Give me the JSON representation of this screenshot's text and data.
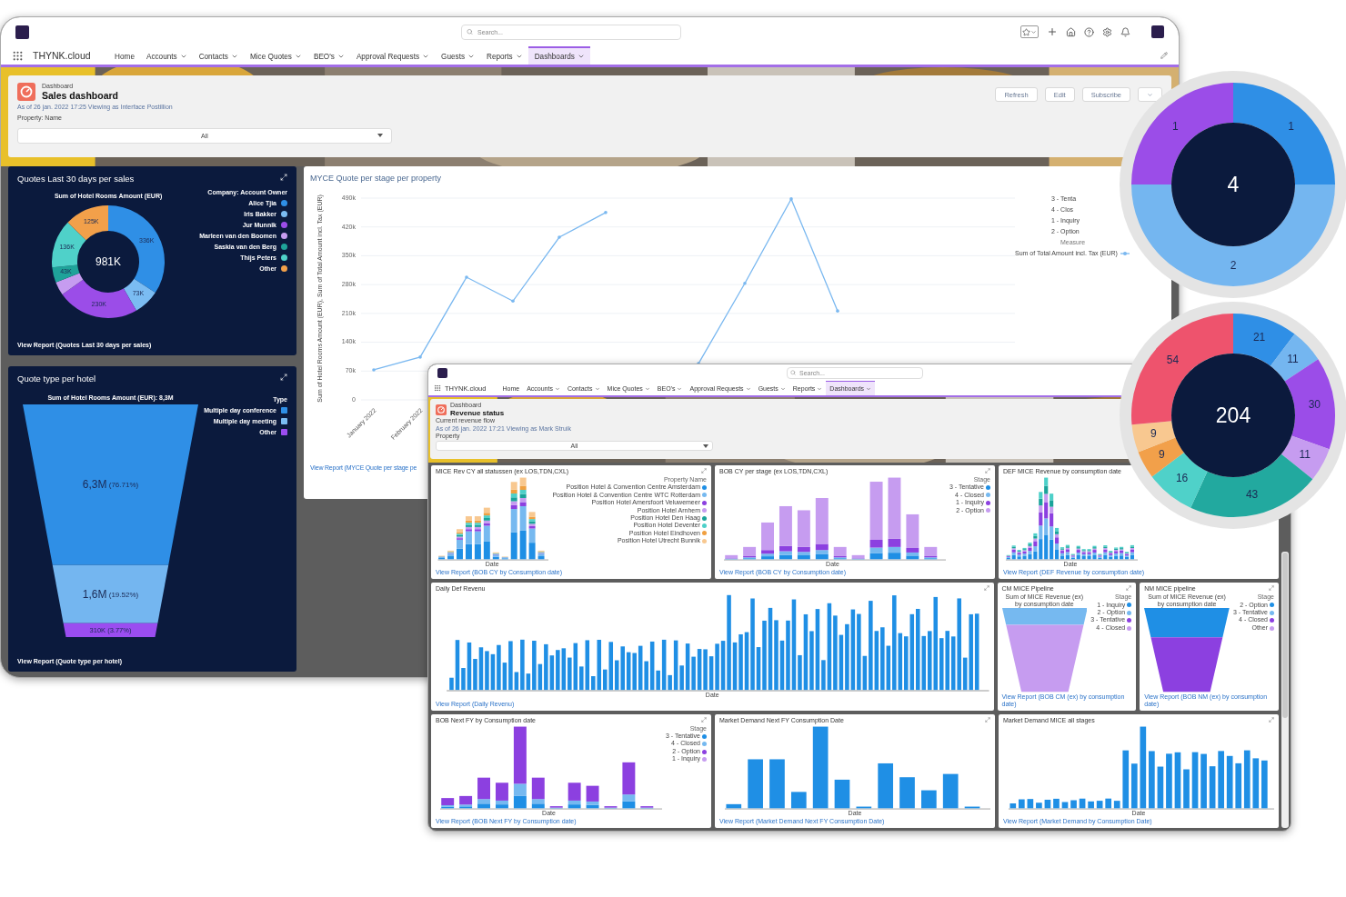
{
  "main_window": {
    "app_name": "THYNK.cloud",
    "search": {
      "placeholder": "Search..."
    },
    "nav": [
      {
        "label": "Home",
        "has_menu": false,
        "selected": false
      },
      {
        "label": "Accounts",
        "has_menu": true,
        "selected": false
      },
      {
        "label": "Contacts",
        "has_menu": true,
        "selected": false
      },
      {
        "label": "Mice Quotes",
        "has_menu": true,
        "selected": false
      },
      {
        "label": "BEO's",
        "has_menu": true,
        "selected": false
      },
      {
        "label": "Approval Requests",
        "has_menu": true,
        "selected": false
      },
      {
        "label": "Guests",
        "has_menu": true,
        "selected": false
      },
      {
        "label": "Reports",
        "has_menu": true,
        "selected": false
      },
      {
        "label": "Dashboards",
        "has_menu": true,
        "selected": true
      }
    ],
    "header": {
      "type_label": "Dashboard",
      "title": "Sales dashboard",
      "meta": "As of 26 jan. 2022 17:25 Viewing as Interface Postillion",
      "filter_label": "Property: Name",
      "filter_value": "All",
      "buttons": [
        "Refresh",
        "Edit",
        "Subscribe"
      ]
    },
    "quotes_panel": {
      "title": "Quotes Last 30 days per sales",
      "subtitle": "Sum of Hotel Rooms Amount (EUR)",
      "total": "981K",
      "legend_title": "Company: Account Owner",
      "link": "View Report (Quotes Last 30 days per sales)",
      "chart_data": {
        "type": "donut",
        "categories": [
          "Alice Tjia",
          "Iris Bakker",
          "Jur Munnik",
          "Marleen van den Boomen",
          "Saskia van den Berg",
          "Thijs Peters",
          "Other"
        ],
        "values": [
          336,
          73,
          230,
          38,
          43,
          136,
          125
        ],
        "colors": [
          "#2f8fe6",
          "#7bbcf2",
          "#9b4de8",
          "#c69cf0",
          "#1fa39a",
          "#4fd1c9",
          "#f2a04a"
        ],
        "value_labels": [
          "336K",
          "73K",
          "230K",
          null,
          "43K",
          "136K",
          "125K"
        ]
      }
    },
    "funnel_panel": {
      "title": "Quote type per hotel",
      "subtitle": "Sum of Hotel Rooms Amount (EUR): 8,3M",
      "legend_title": "Type",
      "link": "View Report (Quote type per hotel)",
      "legend": [
        {
          "label": "Multiple day conference",
          "color": "#2f8fe6"
        },
        {
          "label": "Multiple day meeting",
          "color": "#7bbcf2"
        },
        {
          "label": "Other",
          "color": "#9b4df0"
        }
      ],
      "segments": [
        {
          "value": "6,3M",
          "percent": "(76.71%)",
          "color": "#2f8fe6"
        },
        {
          "value": "1,6M",
          "percent": "(19.52%)",
          "color": "#74b6f0"
        },
        {
          "value": "310K",
          "percent": "(3.77%)",
          "color": "#9b4df0"
        }
      ]
    },
    "line_panel": {
      "title": "MYCE Quote per stage per property",
      "legend": [
        "3 - Tenta",
        "4 - Clos",
        "1 - Inquiry",
        "2 - Option"
      ],
      "measure_title": "Measure",
      "link": "View Report (MYCE Quote per stage pe",
      "chart_data": {
        "type": "line",
        "ylabel": "Sum of Hotel Rooms Amount (EUR), Sum of Total Amount incl. Tax (EUR)",
        "categories": [
          "January 2022",
          "February 2022",
          null,
          null,
          null,
          null,
          null,
          null,
          null,
          null,
          null,
          null
        ],
        "ylim": [
          0,
          490
        ],
        "yticks": [
          {
            "value": 0,
            "label": "0"
          },
          {
            "value": 70,
            "label": "70k"
          },
          {
            "value": 140,
            "label": "140k"
          },
          {
            "value": 210,
            "label": "210k"
          },
          {
            "value": 280,
            "label": "280k"
          },
          {
            "value": 350,
            "label": "350k"
          },
          {
            "value": 420,
            "label": "420k"
          },
          {
            "value": 490,
            "label": "490k"
          }
        ],
        "series": [
          {
            "name": "Sum of Total Amount incl. Tax (EUR)",
            "color": "#7ab8f0",
            "values": [
              73,
              104,
              298,
              240,
              395,
              455,
              null,
              88,
              283,
              488,
              216,
              null
            ]
          }
        ],
        "grid": true
      }
    }
  },
  "revenue_window": {
    "app_name": "THYNK.cloud",
    "search": {
      "placeholder": "Search..."
    },
    "nav": [
      {
        "label": "Home",
        "has_menu": false,
        "selected": false
      },
      {
        "label": "Accounts",
        "has_menu": true,
        "selected": false
      },
      {
        "label": "Contacts",
        "has_menu": true,
        "selected": false
      },
      {
        "label": "Mice Quotes",
        "has_menu": true,
        "selected": false
      },
      {
        "label": "BEO's",
        "has_menu": true,
        "selected": false
      },
      {
        "label": "Approval Requests",
        "has_menu": true,
        "selected": false
      },
      {
        "label": "Guests",
        "has_menu": true,
        "selected": false
      },
      {
        "label": "Reports",
        "has_menu": true,
        "selected": false
      },
      {
        "label": "Dashboards",
        "has_menu": true,
        "selected": true
      }
    ],
    "header": {
      "type_label": "Dashboard",
      "title": "Revenue status",
      "subtitle": "Current revenue flow",
      "meta": "As of 26 jan. 2022 17:21 Viewing as Mark Struik",
      "filter_label": "Property",
      "filter_value": "All"
    },
    "panels": [
      {
        "kind": "stacked_bars",
        "title": "MICE Rev CY all statussen (ex LOS,TDN,CXL)",
        "legend_title": "Property Name",
        "xlabel": "Date",
        "link": "View Report (BOB CY by Consumption date)",
        "legend": [
          {
            "label": "Position Hotel & Convention Centre Amsterdam",
            "color": "#1f8fe5"
          },
          {
            "label": "Position Hotel & Convention Centre WTC Rotterdam",
            "color": "#76b9f0"
          },
          {
            "label": "Position Hotel Amersfoort Veluwemeer",
            "color": "#8c40e0"
          },
          {
            "label": "Position Hotel Arnhem",
            "color": "#c69cf0"
          },
          {
            "label": "Position Hotel Den Haag",
            "color": "#1aa39a"
          },
          {
            "label": "Position Hotel Deventer",
            "color": "#4dd0c9"
          },
          {
            "label": "Position Hotel Eindhoven",
            "color": "#f0a040"
          },
          {
            "label": "Position Hotel Utrecht Bunnik",
            "color": "#f8c890"
          }
        ]
      },
      {
        "kind": "stacked_bars",
        "title": "BOB CY per stage (ex LOS,TDN,CXL)",
        "legend_title": "Stage",
        "xlabel": "Date",
        "link": "View Report (BOB CY by Consumption date)",
        "legend": [
          {
            "label": "3 - Tentative",
            "color": "#1f8fe5"
          },
          {
            "label": "4 - Closed",
            "color": "#76b9f0"
          },
          {
            "label": "1 - Inquiry",
            "color": "#8c40e0"
          },
          {
            "label": "2 - Option",
            "color": "#c69cf0"
          }
        ]
      },
      {
        "kind": "stacked_bars",
        "title": "DEF MICE Revenue by consumption date",
        "xlabel": "Date",
        "link": "View Report (DEF Revenue by consumption date)"
      },
      {
        "kind": "bars",
        "title": "Daily Def Revenu",
        "xlabel": "Date",
        "link": "View Report (Daily Revenu)"
      },
      {
        "kind": "funnel",
        "title": "CM MICE Pipeline",
        "subtitle": "Sum of MICE Revenue (ex) by consumption date",
        "legend_title": "Stage",
        "link": "View Report (BOB CM (ex) by consumption date)",
        "legend": [
          {
            "label": "1 - Inquiry",
            "color": "#1f8fe5"
          },
          {
            "label": "2 - Option",
            "color": "#76b9f0"
          },
          {
            "label": "3 - Tentative",
            "color": "#8c40e0"
          },
          {
            "label": "4 - Closed",
            "color": "#c69cf0"
          }
        ]
      },
      {
        "kind": "funnel",
        "title": "NM MICE pipeline",
        "subtitle": "Sum of MICE Revenue (ex) by consumption date",
        "legend_title": "Stage",
        "link": "View Report (BOB NM (ex) by consumption date)",
        "legend": [
          {
            "label": "2 - Option",
            "color": "#1f8fe5"
          },
          {
            "label": "3 - Tentative",
            "color": "#76b9f0"
          },
          {
            "label": "4 - Closed",
            "color": "#8c40e0"
          },
          {
            "label": "Other",
            "color": "#c69cf0"
          }
        ]
      },
      {
        "kind": "stacked_bars",
        "title": "BOB Next FY by Consumption date",
        "legend_title": "Stage",
        "xlabel": "Date",
        "link": "View Report (BOB Next FY by Consumption date)",
        "legend": [
          {
            "label": "3 - Tentative",
            "color": "#1f8fe5"
          },
          {
            "label": "4 - Closed",
            "color": "#76b9f0"
          },
          {
            "label": "2 - Option",
            "color": "#8c40e0"
          },
          {
            "label": "1 - Inquiry",
            "color": "#c69cf0"
          }
        ]
      },
      {
        "kind": "bars",
        "title": "Market Demand Next FY Consumption Date",
        "xlabel": "Date",
        "link": "View Report (Market Demand Next FY Consumption Date)"
      },
      {
        "kind": "bars",
        "title": "Market Demand MICE all stages",
        "xlabel": "Date",
        "link": "View Report (Market Demand by Consumption Date)"
      }
    ]
  },
  "bubbles": [
    {
      "total": "4",
      "chart_data": {
        "type": "donut",
        "values": [
          1,
          2,
          1
        ],
        "colors": [
          "#2f8fe6",
          "#74b6f0",
          "#9b4de8"
        ],
        "data_labels": true
      }
    },
    {
      "total": "204",
      "chart_data": {
        "type": "donut",
        "values": [
          21,
          11,
          30,
          11,
          43,
          16,
          9,
          9,
          54
        ],
        "colors": [
          "#2f8fe6",
          "#74b6f0",
          "#9b4de8",
          "#c69cf0",
          "#22a99f",
          "#4fd1c9",
          "#f2a04a",
          "#f8c890",
          "#ee536d"
        ],
        "data_labels": true
      }
    }
  ]
}
